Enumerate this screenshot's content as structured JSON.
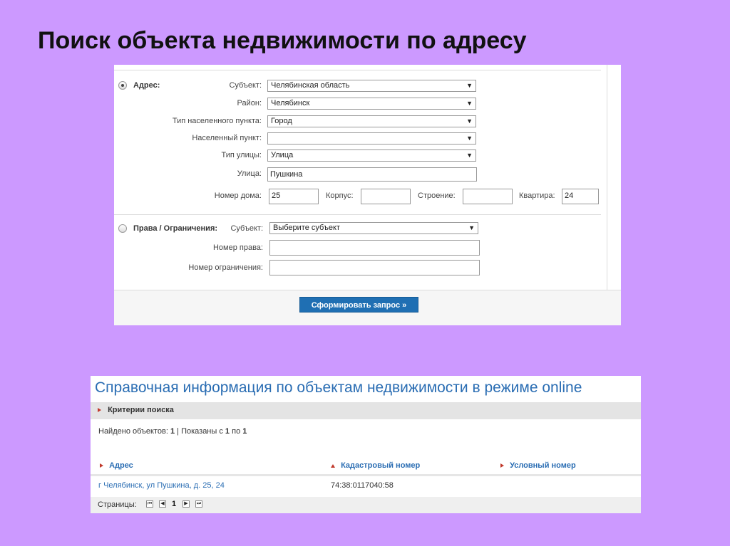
{
  "slide": {
    "title": "Поиск объекта недвижимости по адресу"
  },
  "form": {
    "address_group": {
      "label": "Адрес:",
      "selected": true,
      "subject_label": "Субъект:",
      "subject_value": "Челябинская область",
      "district_label": "Район:",
      "district_value": "Челябинск",
      "locality_type_label": "Тип населенного пункта:",
      "locality_type_value": "Город",
      "locality_label": "Населенный пункт:",
      "locality_value": "",
      "street_type_label": "Тип улицы:",
      "street_type_value": "Улица",
      "street_label": "Улица:",
      "street_value": "Пушкина",
      "house_label": "Номер дома:",
      "house_value": "25",
      "building_label": "Корпус:",
      "building_value": "",
      "structure_label": "Строение:",
      "structure_value": "",
      "apartment_label": "Квартира:",
      "apartment_value": "24"
    },
    "rights_group": {
      "label": "Права / Ограничения:",
      "selected": false,
      "subject_label": "Субъект:",
      "subject_value": "Выберите субъект",
      "right_number_label": "Номер права:",
      "right_number_value": "",
      "restriction_number_label": "Номер ограничения:",
      "restriction_number_value": ""
    },
    "submit_label": "Сформировать запрос »"
  },
  "results": {
    "title": "Справочная информация по объектам недвижимости в режиме online",
    "criteria_label": "Критерии поиска",
    "found_prefix": "Найдено объектов:",
    "found_count": "1",
    "shown_prefix": "Показаны с",
    "shown_from": "1",
    "shown_mid": "по",
    "shown_to": "1",
    "columns": [
      "Адрес",
      "Кадастровый номер",
      "Условный номер"
    ],
    "rows": [
      {
        "address": "г Челябинск, ул Пушкина, д. 25, 24",
        "cadastral": "74:38:0117040:58",
        "conditional": ""
      }
    ],
    "pages_label": "Страницы:",
    "current_page": "1"
  },
  "colors": {
    "background": "#cc99ff",
    "link": "#2a6db3",
    "button": "#1f6fb3",
    "marker": "#c0392b"
  }
}
